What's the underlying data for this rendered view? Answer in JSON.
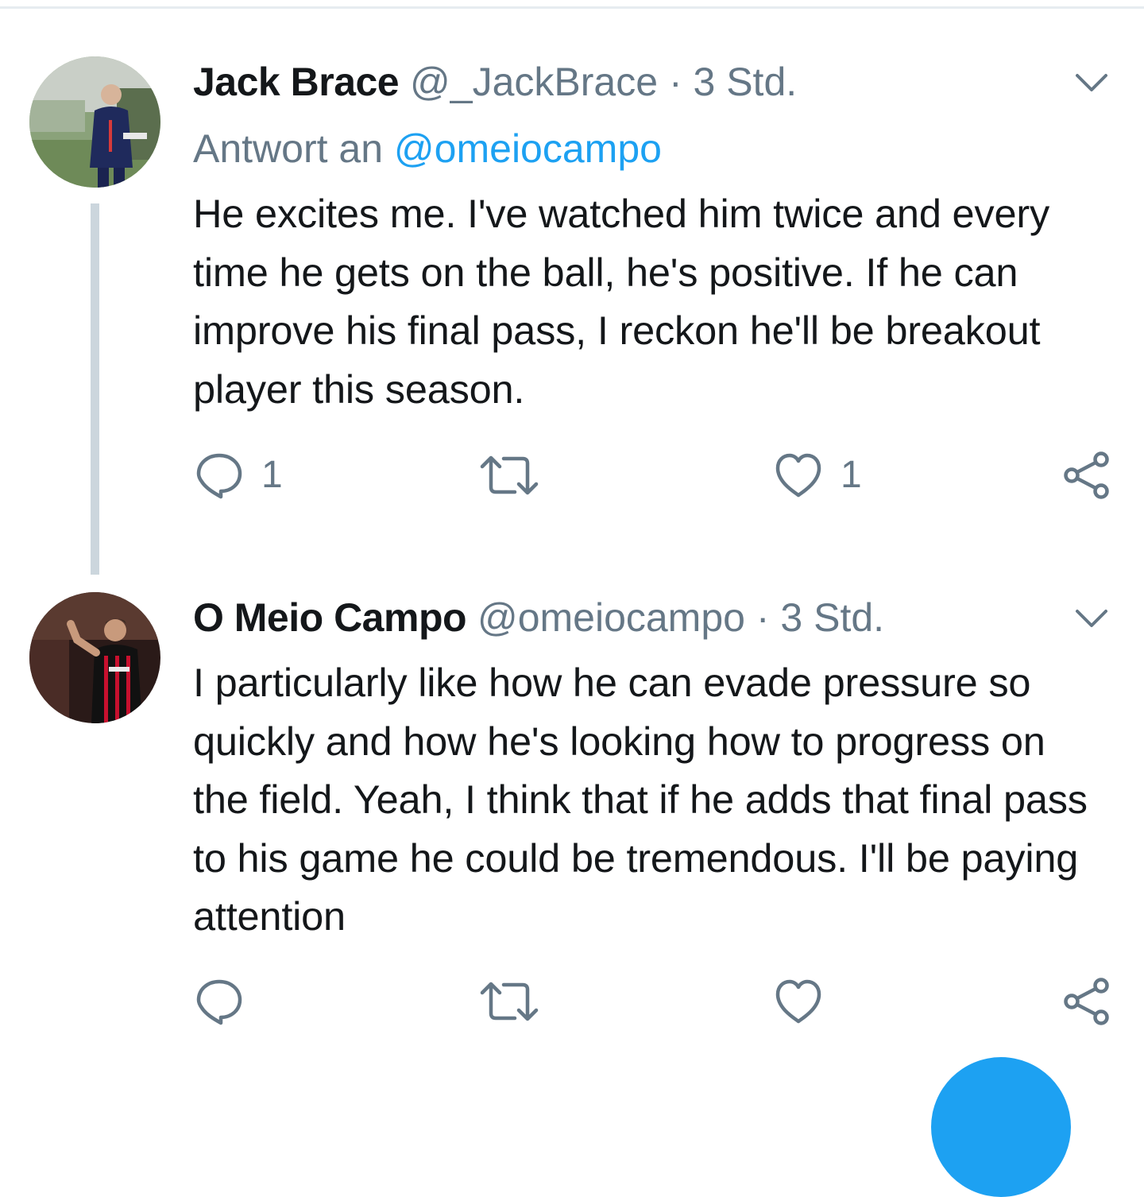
{
  "tweets": [
    {
      "name": "Jack Brace",
      "handle": "@_JackBrace",
      "separator": "·",
      "time": "3 Std.",
      "reply_prefix": "Antwort an",
      "reply_mention": "@omeiocampo",
      "text": "He excites me. I've watched him twice and every time he gets on the ball, he's positive. If he can improve his final pass, I reckon he'll be breakout player this season.",
      "reply_count": "1",
      "retweet_count": "",
      "like_count": "1"
    },
    {
      "name": "O Meio Campo",
      "handle": "@omeiocampo",
      "separator": "·",
      "time": "3 Std.",
      "text": "I particularly like how he can evade pressure so quickly and how he's looking how to progress on the field. Yeah, I think that if he adds that final pass to his game he could be tremendous. I'll be paying attention",
      "reply_count": "",
      "retweet_count": "",
      "like_count": ""
    }
  ],
  "icons": {
    "reply": "speech-bubble-icon",
    "retweet": "retweet-icon",
    "like": "heart-icon",
    "share": "share-icon",
    "more": "chevron-down-icon"
  },
  "colors": {
    "primary_text": "#14171a",
    "secondary_text": "#657786",
    "accent": "#1da1f2",
    "thread_line": "#ccd6dd"
  }
}
